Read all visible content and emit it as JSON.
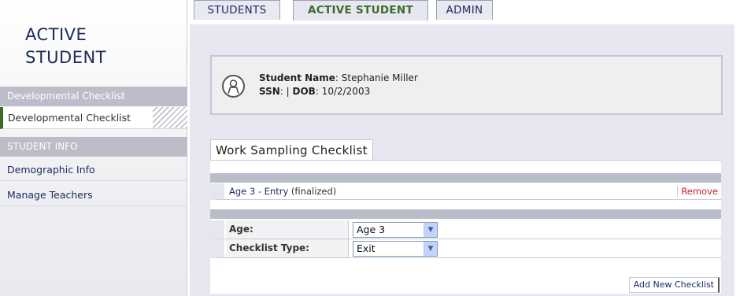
{
  "sidebar": {
    "title_line1": "ACTIVE",
    "title_line2": "STUDENT",
    "sections": [
      {
        "header": "Developmental Checklist",
        "items": [
          {
            "label": "Developmental Checklist",
            "active": true
          }
        ]
      },
      {
        "header": "STUDENT INFO",
        "items": [
          {
            "label": "Demographic Info"
          },
          {
            "label": "Manage Teachers"
          }
        ]
      }
    ]
  },
  "tabs": [
    {
      "label": "STUDENTS"
    },
    {
      "label": "ACTIVE STUDENT",
      "active": true
    },
    {
      "label": "ADMIN"
    }
  ],
  "student": {
    "name_label": "Student Name",
    "name": ": Stephanie Miller",
    "ssn_label": "SSN",
    "ssn_sep": ": | ",
    "dob_label": "DOB",
    "dob": ": 10/2/2003"
  },
  "checklist": {
    "section_title": "Work Sampling Checklist",
    "entry_link": "Age 3 - Entry",
    "entry_status": " (finalized)",
    "remove_label": "Remove",
    "form": {
      "age_label": "Age:",
      "age_value": "Age 3",
      "type_label": "Checklist Type:",
      "type_value": "Exit"
    },
    "add_button": "Add New Checklist"
  },
  "icons": {
    "avatar": "user-avatar-icon",
    "dropdown": "chevron-down-icon"
  },
  "colors": {
    "accent_green": "#3d6b2c",
    "link_blue": "#1d2a66",
    "remove_red": "#c8232b",
    "main_bg": "#e6e7f0"
  }
}
